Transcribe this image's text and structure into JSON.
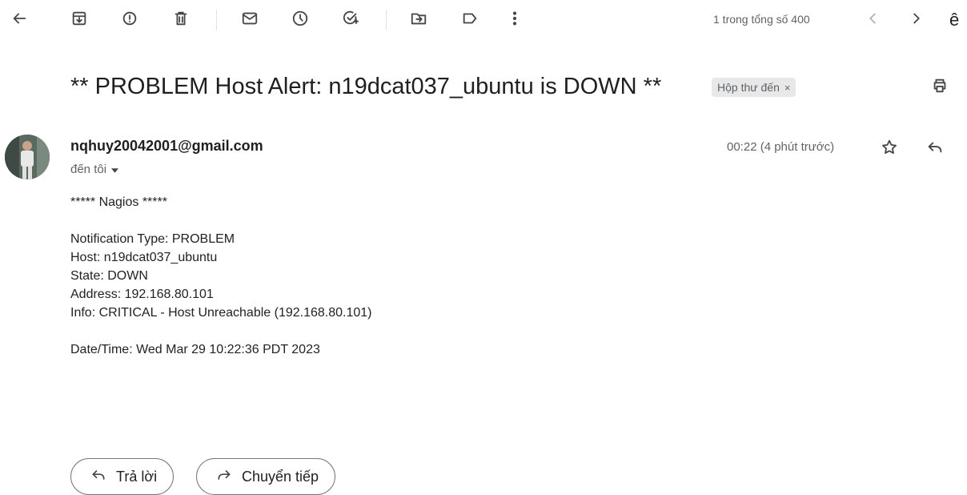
{
  "toolbar": {
    "back_icon": "arrow-left-icon",
    "actions": [
      "archive-icon",
      "report-spam-icon",
      "delete-icon",
      "mark-unread-icon",
      "snooze-icon",
      "add-task-icon",
      "move-to-icon",
      "label-icon",
      "more-vert-icon"
    ]
  },
  "pager": {
    "text": "1 trong tổng số 400",
    "input_tools_glyph": "ê"
  },
  "email": {
    "subject": "** PROBLEM Host Alert: n19dcat037_ubuntu is DOWN **",
    "label": "Hộp thư đến",
    "label_remove": "×",
    "sender": "nqhuy20042001@gmail.com",
    "recipient": "đến tôi",
    "time": "00:22 (4 phút trước)",
    "body_lines": [
      "***** Nagios *****",
      "",
      "Notification Type: PROBLEM",
      "Host: n19dcat037_ubuntu",
      "State: DOWN",
      "Address: 192.168.80.101",
      "Info: CRITICAL - Host Unreachable (192.168.80.101)",
      "",
      "Date/Time: Wed Mar 29 10:22:36 PDT 2023"
    ]
  },
  "actions": {
    "reply": "Trả lời",
    "forward": "Chuyển tiếp"
  },
  "colors": {
    "label_chip_bg": "#e8e8e8",
    "icon_gray": "#444746",
    "text_secondary": "#5f6368"
  }
}
